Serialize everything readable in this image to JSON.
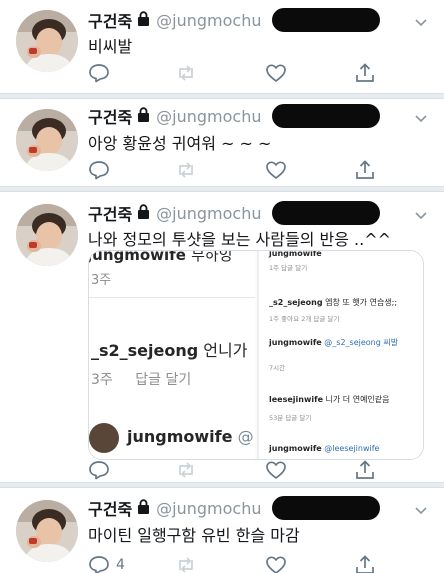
{
  "profile": {
    "name": "구건죽",
    "handle": "@jungmochu"
  },
  "tweets": [
    {
      "text": "비씨발",
      "reply_count": ""
    },
    {
      "text": "아앙 황윤성 귀여워 ~ ~  ~",
      "reply_count": ""
    },
    {
      "text": "나와 정모의 투샷을 보는 사람들의 반응 ..^^",
      "reply_count": ""
    },
    {
      "text": "마이틴 일행구함 유빈 한슬 마감",
      "reply_count": "4"
    }
  ],
  "media": {
    "left": {
      "top_user": "jungmowife",
      "top_text": "부하잉",
      "top_meta": "3주",
      "comment_user": "_s2_sejeong",
      "comment_text": "언니가",
      "comment_meta_time": "3주",
      "comment_meta_reply": "답글 달기",
      "bottom_user": "jungmowife",
      "bottom_text": "@"
    },
    "right": {
      "r1_user": "jungmowife",
      "r1_meta": "1주   답글 달기",
      "r2_user": "_s2_sejeong",
      "r2_text": "엡창 또 햇가 연습생;;",
      "r2_meta": "1주   좋아요 2개   답글 달기",
      "r3_user": "jungmowife",
      "r3_text": "@_s2_sejeong 씨발",
      "r3_meta": "7시간",
      "r4_user": "leesejinwife",
      "r4_text": "니가 더 연예인같음",
      "r4_meta": "53분   답글 달기",
      "r5_user": "jungmowife",
      "r5_text": "@leesejinwife"
    }
  },
  "icons": [
    "reply-icon",
    "retweet-icon",
    "like-icon",
    "share-icon",
    "lock-icon",
    "caret-down-icon"
  ],
  "colors": {
    "text": "#14171a",
    "muted": "#657786",
    "divider": "#e6ecf0",
    "redaction": "#0b0b0b"
  }
}
